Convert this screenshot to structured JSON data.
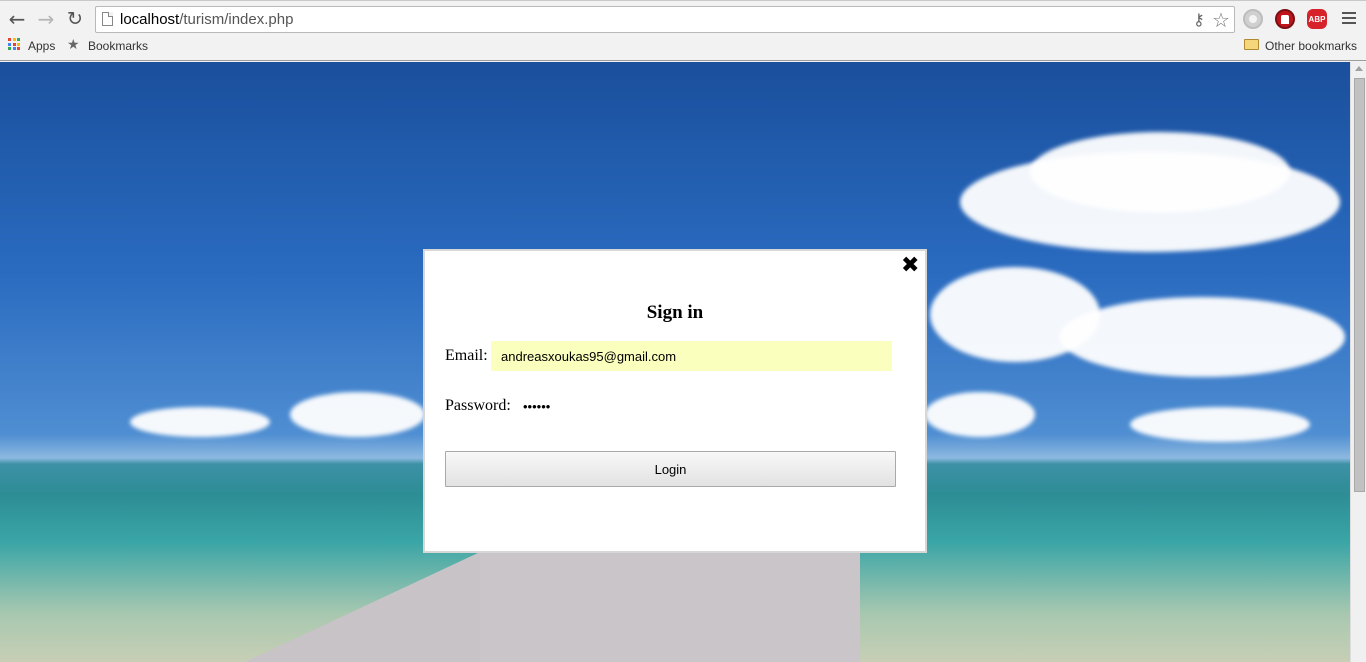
{
  "browser": {
    "url_host": "localhost",
    "url_path": "/turism/index.php",
    "nav_back_icon": "arrow-left-icon",
    "nav_forward_icon": "arrow-right-icon",
    "reload_icon": "reload-icon",
    "extensions": [
      "extension-gray-icon",
      "ublock-icon",
      "adblock-plus-icon"
    ],
    "abp_text": "ABP"
  },
  "bookmarks_bar": {
    "apps_label": "Apps",
    "bookmarks_label": "Bookmarks",
    "other_bookmarks_label": "Other bookmarks"
  },
  "modal": {
    "title": "Sign in",
    "email_label": "Email:",
    "email_value": "andreasxoukas95@gmail.com",
    "password_label": "Password:",
    "password_value": "hunter",
    "login_label": "Login",
    "close_glyph": "✖"
  },
  "colors": {
    "autofill_bg": "#faffbd",
    "abp_red": "#d8222a",
    "ublock_red": "#c0141b"
  }
}
